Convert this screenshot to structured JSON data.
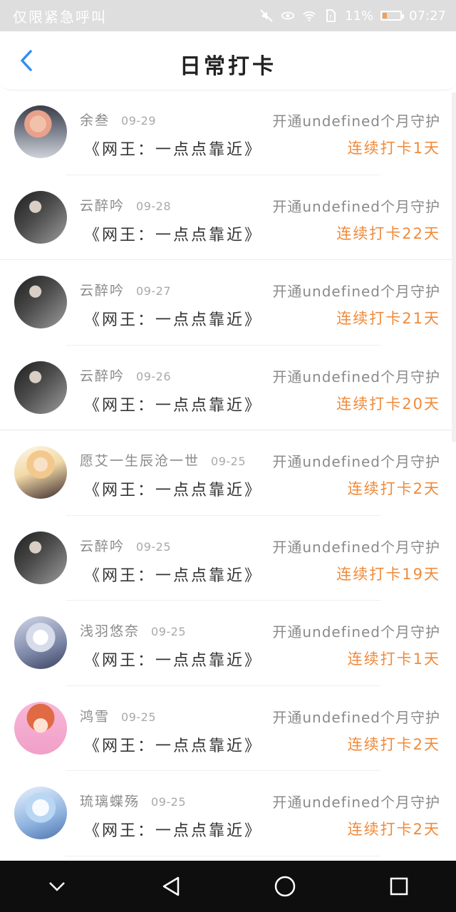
{
  "status_bar": {
    "left_text": "仅限紧急呼叫",
    "signal_pct": "11%",
    "time": "07:27",
    "battery_level_pct": 25
  },
  "header": {
    "title": "日常打卡",
    "back_icon": "chevron-left-icon"
  },
  "colors": {
    "accent_blue": "#2f8ff0",
    "streak_orange": "#f08a3a",
    "muted_text": "#8a8a8a"
  },
  "items": [
    {
      "name": "余叁",
      "date": "09-29",
      "book": "《网王：一点点靠近》",
      "guard": "开通undefined个月守护",
      "streak": "连续打卡1天",
      "divider": "inset"
    },
    {
      "name": "云醉吟",
      "date": "09-28",
      "book": "《网王：一点点靠近》",
      "guard": "开通undefined个月守护",
      "streak": "连续打卡22天",
      "divider": "full"
    },
    {
      "name": "云醉吟",
      "date": "09-27",
      "book": "《网王：一点点靠近》",
      "guard": "开通undefined个月守护",
      "streak": "连续打卡21天",
      "divider": "inset"
    },
    {
      "name": "云醉吟",
      "date": "09-26",
      "book": "《网王：一点点靠近》",
      "guard": "开通undefined个月守护",
      "streak": "连续打卡20天",
      "divider": "full"
    },
    {
      "name": "愿艾一生辰沧一世",
      "date": "09-25",
      "book": "《网王：一点点靠近》",
      "guard": "开通undefined个月守护",
      "streak": "连续打卡2天",
      "divider": "inset"
    },
    {
      "name": "云醉吟",
      "date": "09-25",
      "book": "《网王：一点点靠近》",
      "guard": "开通undefined个月守护",
      "streak": "连续打卡19天",
      "divider": "inset"
    },
    {
      "name": "浅羽悠奈",
      "date": "09-25",
      "book": "《网王：一点点靠近》",
      "guard": "开通undefined个月守护",
      "streak": "连续打卡1天",
      "divider": "inset"
    },
    {
      "name": "鸿雪",
      "date": "09-25",
      "book": "《网王：一点点靠近》",
      "guard": "开通undefined个月守护",
      "streak": "连续打卡2天",
      "divider": "inset"
    },
    {
      "name": "琉璃蝶殇",
      "date": "09-25",
      "book": "《网王：一点点靠近》",
      "guard": "开通undefined个月守护",
      "streak": "连续打卡2天",
      "divider": "inset"
    }
  ],
  "nav_bar": {
    "buttons": [
      "chevron-down-icon",
      "back-triangle-icon",
      "home-circle-icon",
      "recents-square-icon"
    ]
  }
}
